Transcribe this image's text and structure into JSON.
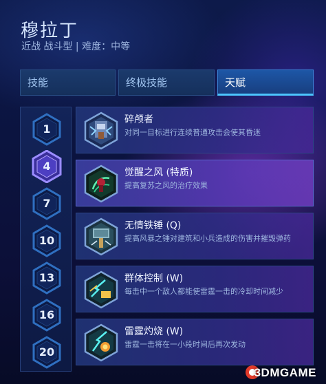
{
  "hero": {
    "name": "穆拉丁",
    "subtitle": "近战 战斗型 | 难度：中等"
  },
  "tabs": [
    {
      "label": "技能",
      "active": false
    },
    {
      "label": "终极技能",
      "active": false
    },
    {
      "label": "天赋",
      "active": true
    }
  ],
  "levels": [
    {
      "label": "1",
      "selected": false
    },
    {
      "label": "4",
      "selected": true
    },
    {
      "label": "7",
      "selected": false
    },
    {
      "label": "10",
      "selected": false
    },
    {
      "label": "13",
      "selected": false
    },
    {
      "label": "16",
      "selected": false
    },
    {
      "label": "20",
      "selected": false
    }
  ],
  "talents": [
    {
      "name": "碎颅者",
      "desc": "对同一目标进行连续普通攻击会使其昏迷",
      "icon": "skull-cracker-icon"
    },
    {
      "name": "觉醒之风 (特质)",
      "desc": "提高复苏之风的治疗效果",
      "icon": "second-wind-icon"
    },
    {
      "name": "无情铁锤 (Q)",
      "desc": "提高风暴之锤对建筑和小兵造成的伤害并摧毁弹药",
      "icon": "relentless-hammer-icon"
    },
    {
      "name": "群体控制 (W)",
      "desc": "每击中一个敌人都能使雷霆一击的冷却时间减少",
      "icon": "crowd-control-icon"
    },
    {
      "name": "雷霆灼烧 (W)",
      "desc": "雷霆一击将在一小段时间后再次发动",
      "icon": "thunder-burn-icon"
    }
  ],
  "watermark": "3DMGAME",
  "colors": {
    "accent": "#4cc6ff",
    "selected_level": "#7a6cff",
    "level_ring": "#3a7fd0"
  }
}
